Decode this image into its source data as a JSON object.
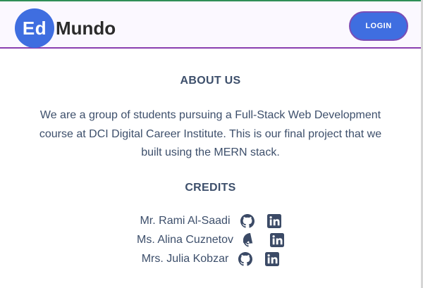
{
  "header": {
    "logo_badge": "Ed",
    "logo_word": "Mundo",
    "login_label": "LOGIN"
  },
  "about": {
    "heading": "ABOUT US",
    "lines": [
      "We are a group of students pursuing a Full-Stack Web Development",
      "course at DCI Digital Career Institute. This is our final project that we",
      "built using the MERN stack."
    ]
  },
  "credits": {
    "heading": "CREDITS",
    "people": [
      {
        "name": "Mr. Rami Al-Saadi",
        "icons": [
          "github-icon",
          "linkedin-icon"
        ]
      },
      {
        "name": "Ms. Alina Cuznetov",
        "icons": [
          "github-icon",
          "linkedin-icon"
        ]
      },
      {
        "name": "Mrs. Julia Kobzar",
        "icons": [
          "github-icon",
          "linkedin-icon"
        ]
      }
    ]
  },
  "colors": {
    "brand_blue": "#3f6ee0",
    "nav_border_purple": "#8a3fb0",
    "text_slate": "#3d4f6b",
    "icon_dark": "#3b4a66"
  }
}
